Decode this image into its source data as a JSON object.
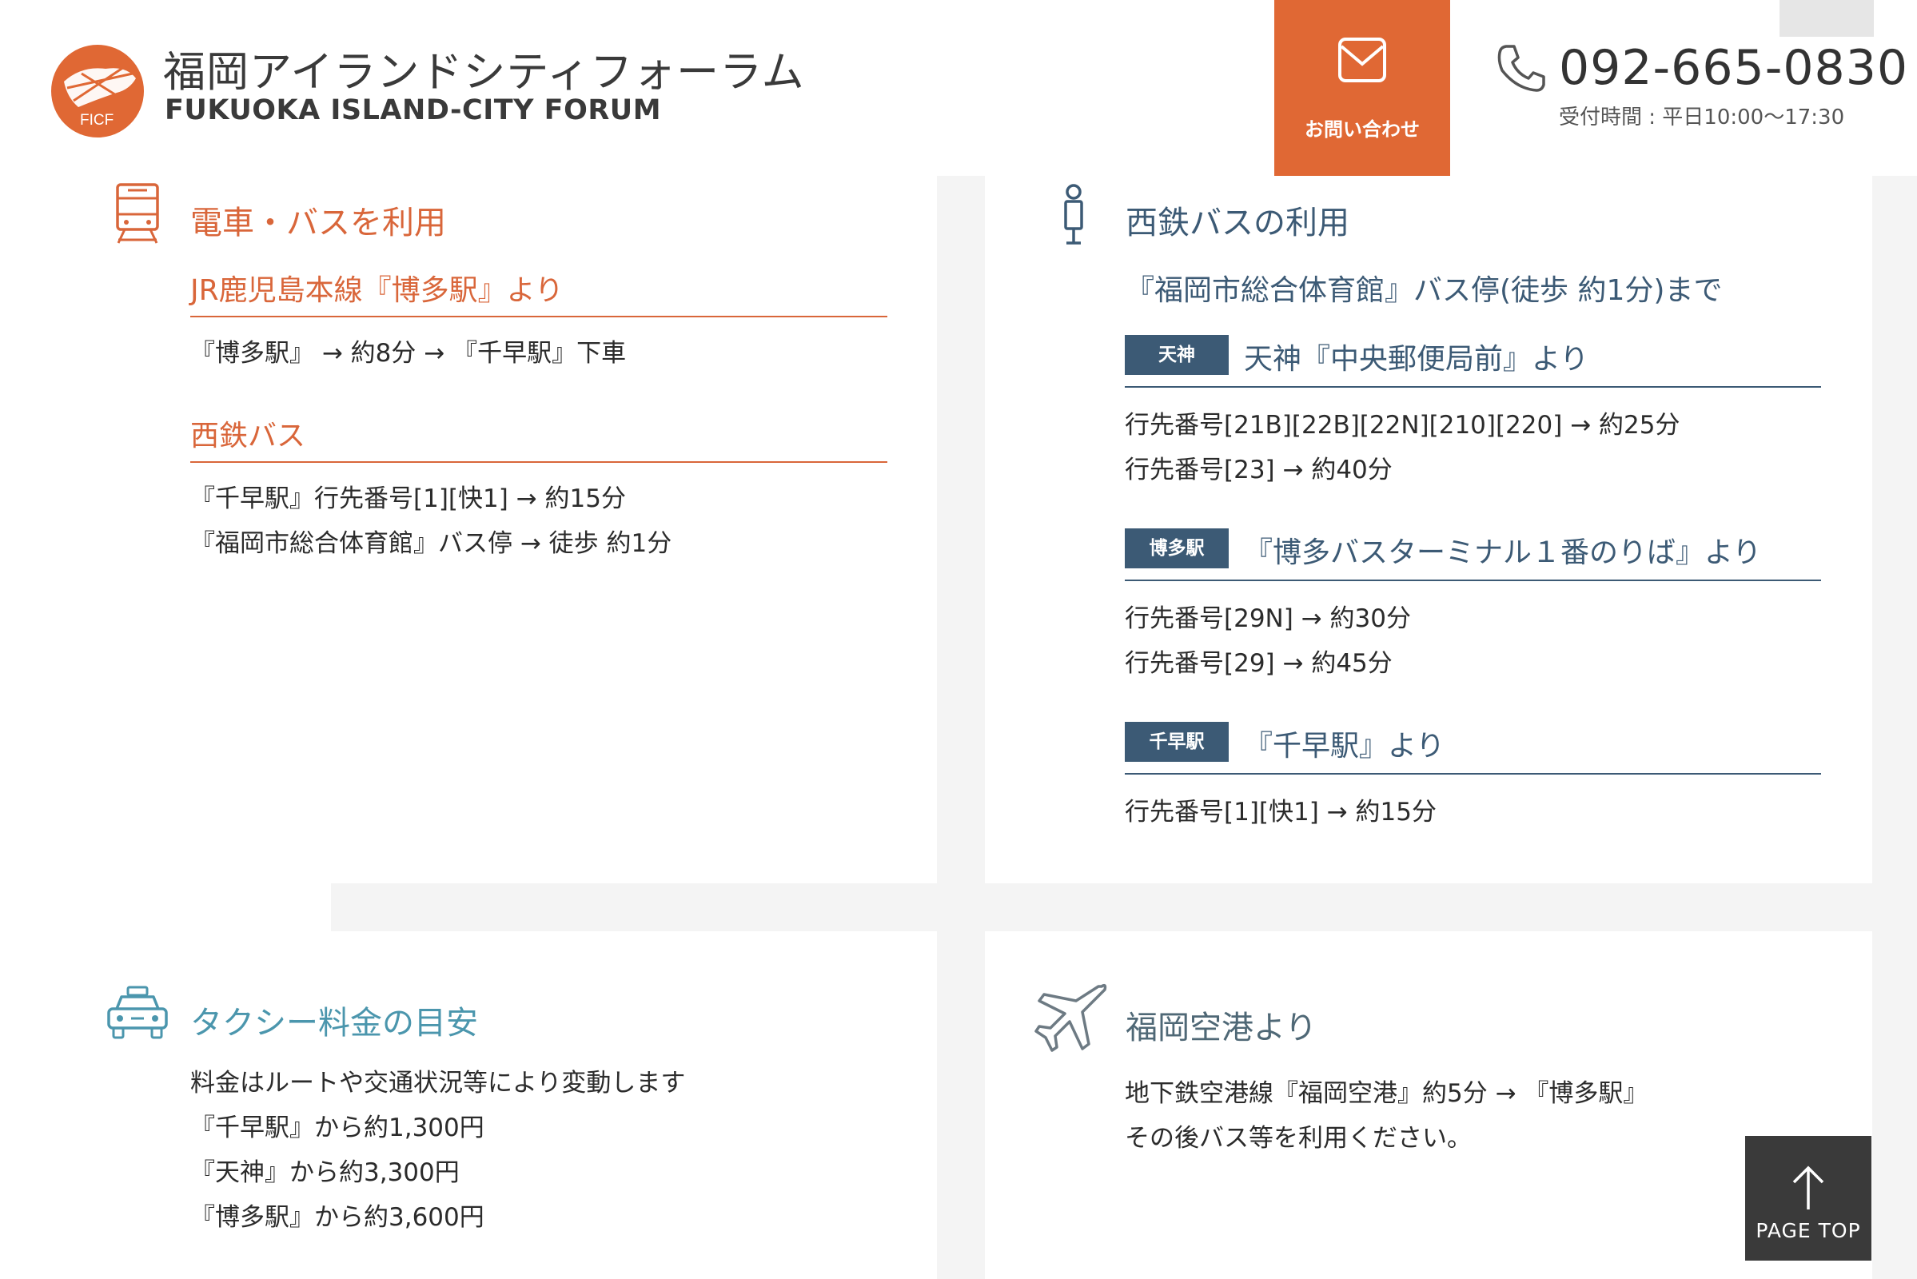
{
  "header": {
    "logo_badge": "FICF",
    "logo_ja": "福岡アイランドシティフォーラム",
    "logo_en": "FUKUOKA ISLAND-CITY FORUM",
    "contact_label": "お問い合わせ",
    "phone": "092-665-0830",
    "hours": "受付時間 : 平日10:00～17:30"
  },
  "train_bus": {
    "title": "電車・バスを利用",
    "jr_title": "JR鹿児島本線『博多駅』より",
    "jr_line": "『博多駅』 → 約8分 → 『千早駅』下車",
    "nishitetsu_title": "西鉄バス",
    "nishitetsu_lines": [
      "『千早駅』行先番号[1][快1] → 約15分",
      "『福岡市総合体育館』バス停 → 徒歩 約1分"
    ]
  },
  "nishitetsu_bus": {
    "title": "西鉄バスの利用",
    "subtitle": "『福岡市総合体育館』バス停(徒歩 約1分)まで",
    "routes": [
      {
        "badge": "天神",
        "title": "天神『中央郵便局前』より",
        "lines": [
          "行先番号[21B][22B][22N][210][220] → 約25分",
          "行先番号[23] → 約40分"
        ]
      },
      {
        "badge": "博多駅",
        "title": "『博多バスターミナル１番のりば』より",
        "lines": [
          "行先番号[29N] → 約30分",
          "行先番号[29] → 約45分"
        ]
      },
      {
        "badge": "千早駅",
        "title": "『千早駅』より",
        "lines": [
          "行先番号[1][快1] → 約15分"
        ]
      }
    ]
  },
  "taxi": {
    "title": "タクシー料金の目安",
    "lines": [
      "料金はルートや交通状況等により変動します",
      "『千早駅』から約1,300円",
      "『天神』から約3,300円",
      "『博多駅』から約3,600円"
    ]
  },
  "airport": {
    "title": "福岡空港より",
    "lines": [
      "地下鉄空港線『福岡空港』約5分 → 『博多駅』",
      "その後バス等を利用ください。"
    ]
  },
  "page_top_label": "PAGE TOP",
  "colors": {
    "orange": "#d9663a",
    "navy": "#3c5a75",
    "teal": "#4b96ad",
    "contact_bg": "#e06834",
    "page_top_bg": "#3a3a3a"
  },
  "icons": [
    "logo-mark-icon",
    "mail-icon",
    "phone-icon",
    "train-icon",
    "bus-stop-icon",
    "taxi-icon",
    "airplane-icon",
    "arrow-up-icon"
  ]
}
